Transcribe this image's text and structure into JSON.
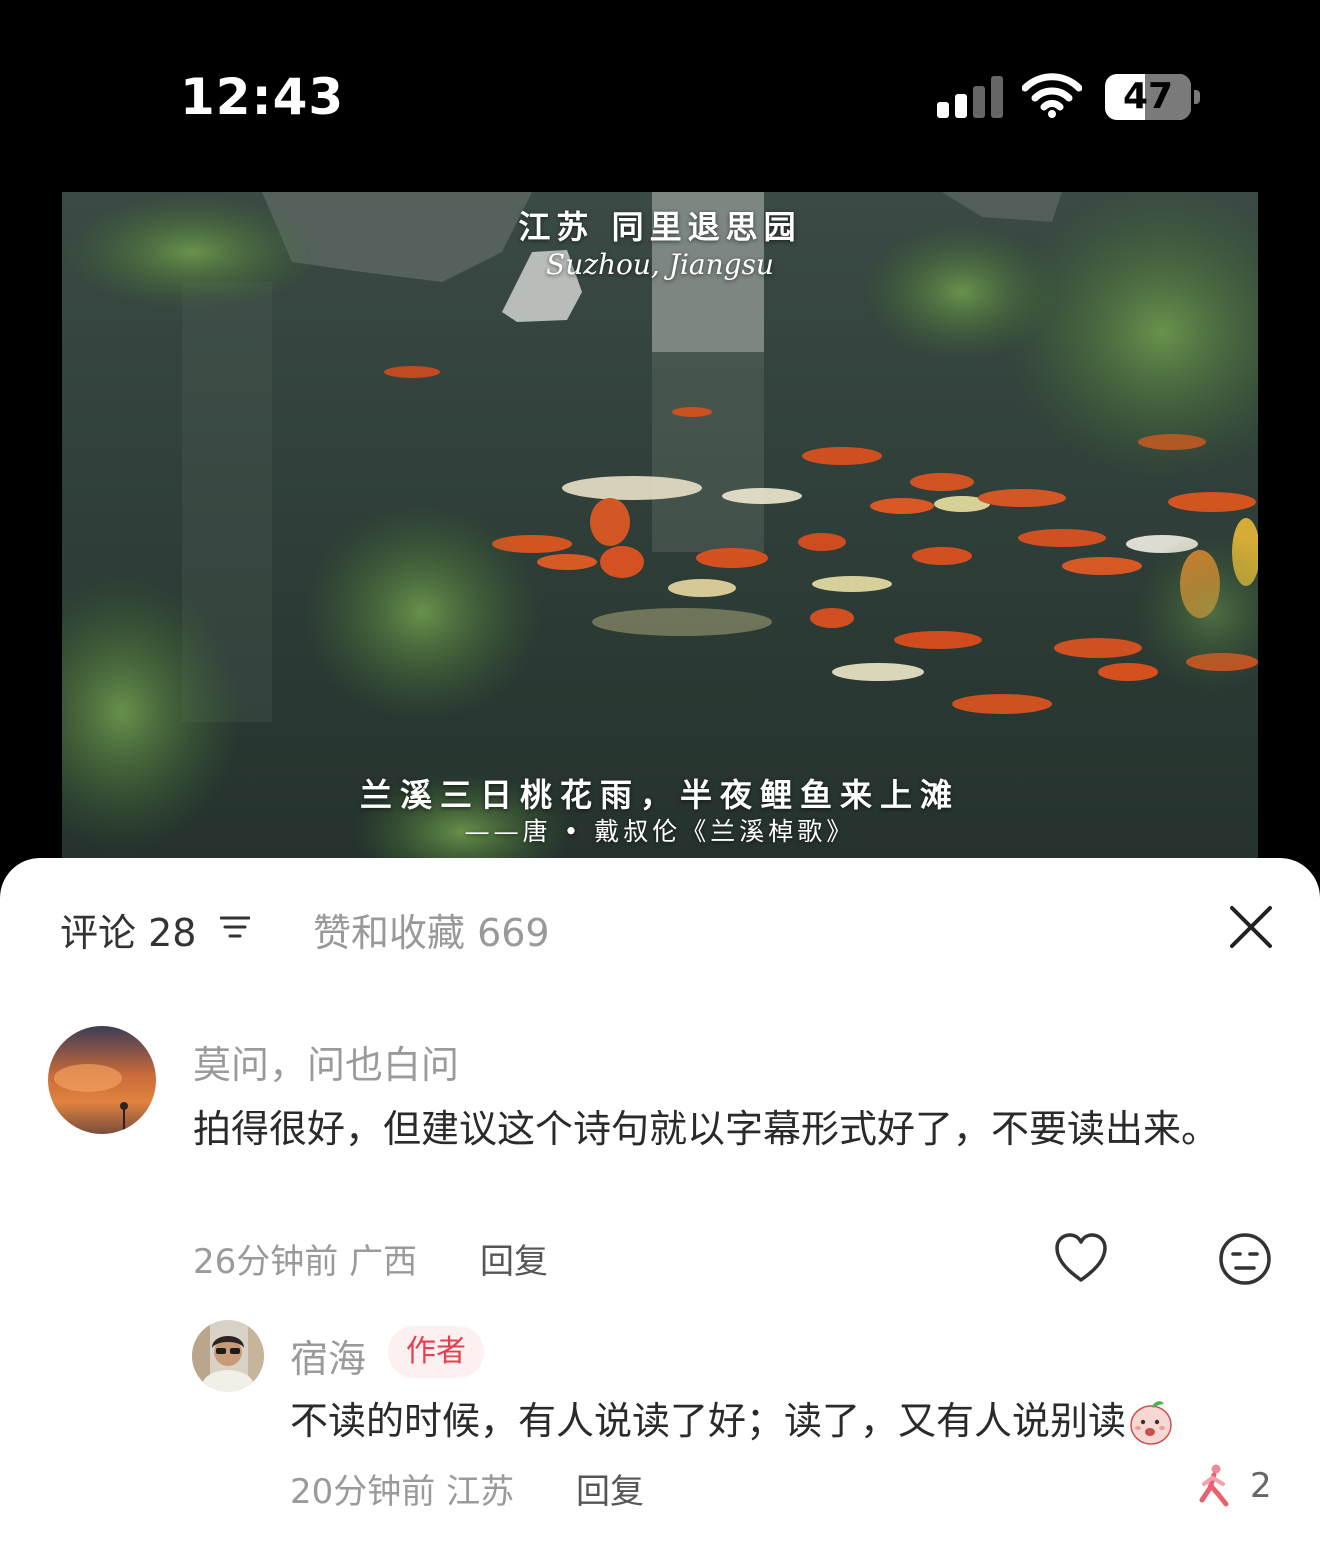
{
  "status_bar": {
    "time": "12:43",
    "battery": "47",
    "battery_level": 0.47
  },
  "video": {
    "location_cn": "江苏 同里退思园",
    "location_en": "Suzhou, Jiangsu",
    "poem": "兰溪三日桃花雨，半夜鲤鱼来上滩",
    "poem_source": "——唐 • 戴叔伦《兰溪棹歌》"
  },
  "sheet": {
    "tab_comments": "评论 28",
    "tab_likes": "赞和收藏 669",
    "icons": {
      "sort": "sort-lines-icon",
      "close": "close-icon"
    }
  },
  "comments": [
    {
      "user": "莫问，问也白问",
      "text": "拍得很好，但建议这个诗句就以字幕形式好了，不要读出来。",
      "meta": "26分钟前 广西",
      "reply": "回复"
    }
  ],
  "replies": [
    {
      "user": "宿海",
      "badge": "作者",
      "text": "不读的时候，有人说读了好；读了，又有人说别读",
      "meta": "20分钟前 江苏",
      "reply": "回复",
      "like_count": "2"
    }
  ],
  "colors": {
    "badge_text": "#e5404f",
    "badge_bg": "#fdf0f1",
    "muted": "#9a9a9a"
  }
}
